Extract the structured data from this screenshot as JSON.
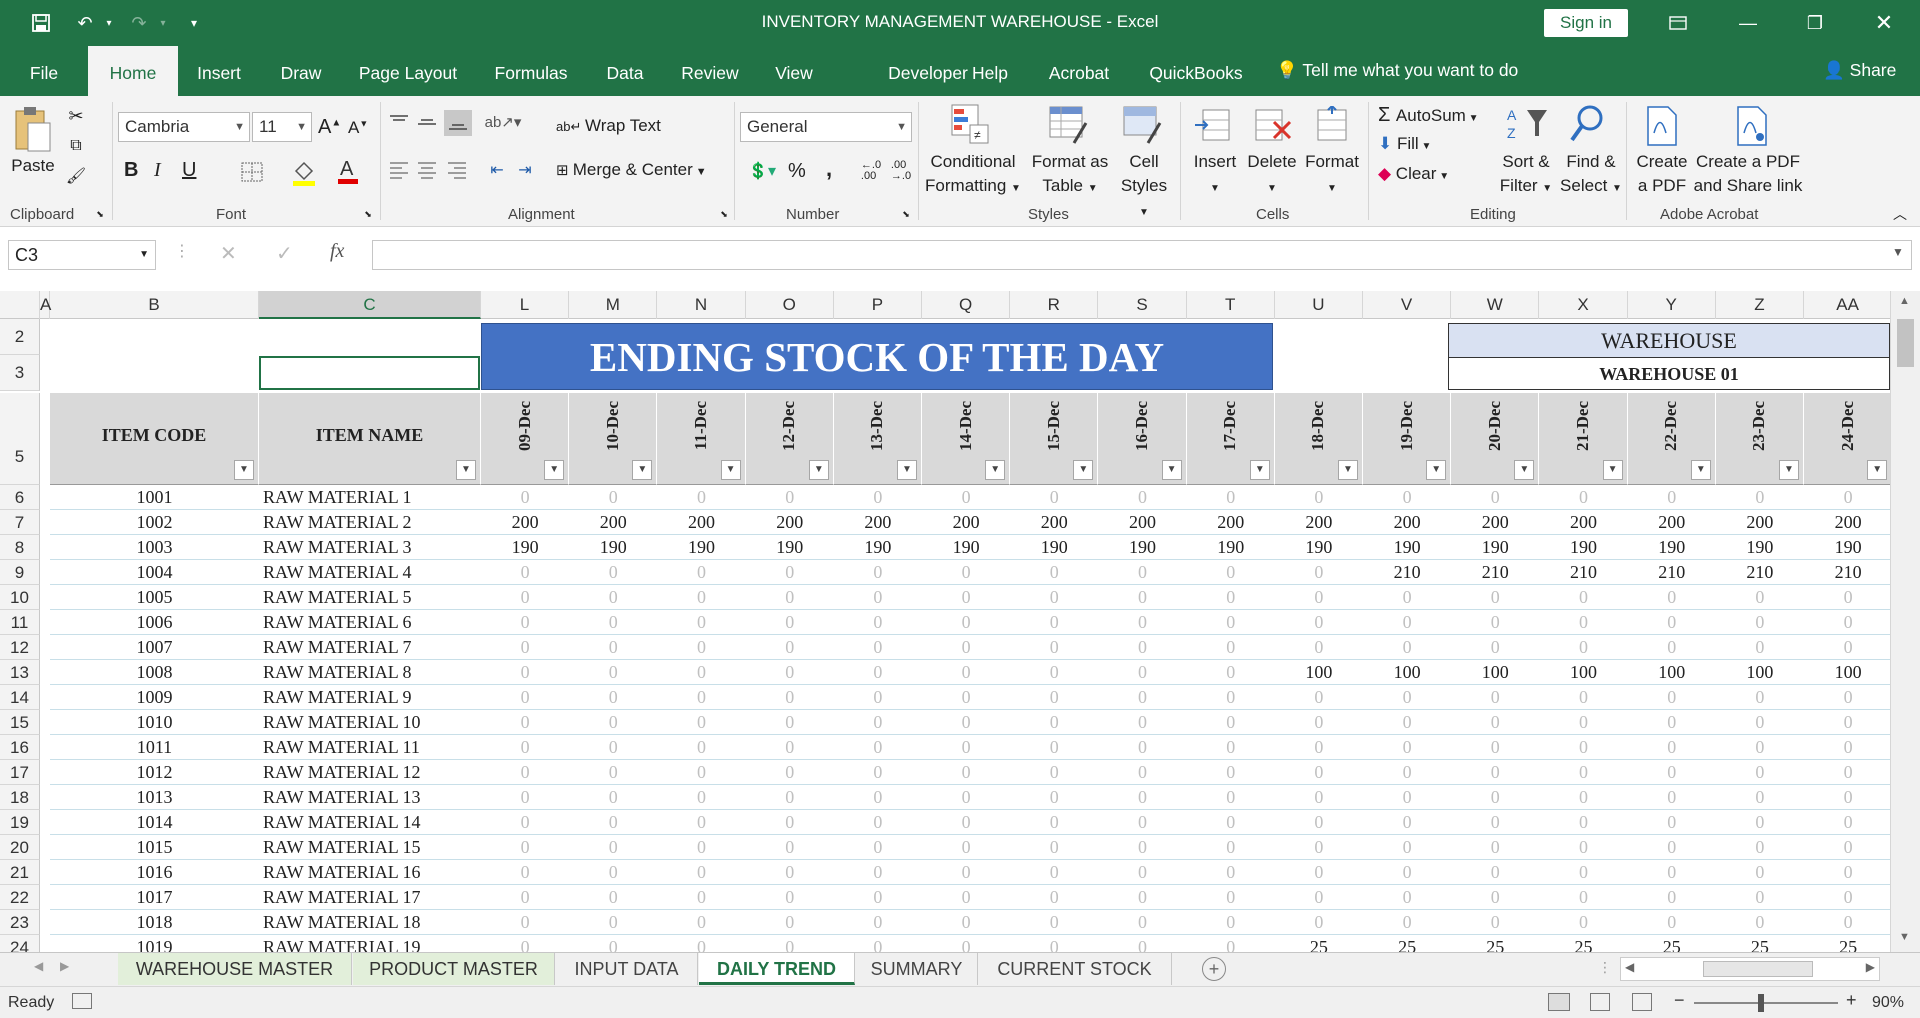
{
  "window": {
    "title": "INVENTORY MANAGEMENT WAREHOUSE  -  Excel",
    "sign_in": "Sign in"
  },
  "menu": {
    "tabs": [
      "File",
      "Home",
      "Insert",
      "Draw",
      "Page Layout",
      "Formulas",
      "Data",
      "Review",
      "View",
      "Developer",
      "Help",
      "Acrobat",
      "QuickBooks"
    ],
    "active": "Home",
    "tell_me": "Tell me what you want to do",
    "share": "Share"
  },
  "ribbon": {
    "clipboard": {
      "label": "Clipboard",
      "paste": "Paste"
    },
    "font": {
      "label": "Font",
      "family": "Cambria",
      "size": "11",
      "bold": "B",
      "italic": "I",
      "underline": "U"
    },
    "alignment": {
      "label": "Alignment",
      "wrap_text": "Wrap Text",
      "merge_center": "Merge & Center"
    },
    "number": {
      "label": "Number",
      "format": "General",
      "percent": "%",
      "comma": ","
    },
    "styles": {
      "label": "Styles",
      "conditional_1": "Conditional",
      "conditional_2": "Formatting",
      "format_table_1": "Format as",
      "format_table_2": "Table",
      "cell_styles_1": "Cell",
      "cell_styles_2": "Styles"
    },
    "cells": {
      "label": "Cells",
      "insert": "Insert",
      "delete": "Delete",
      "format": "Format"
    },
    "editing": {
      "label": "Editing",
      "autosum": "AutoSum",
      "fill": "Fill",
      "clear": "Clear",
      "sort_1": "Sort &",
      "sort_2": "Filter",
      "find_1": "Find &",
      "find_2": "Select"
    },
    "acrobat": {
      "label": "Adobe Acrobat",
      "create_pdf_1": "Create",
      "create_pdf_2": "a PDF",
      "share_pdf_1": "Create a PDF",
      "share_pdf_2": "and Share link"
    }
  },
  "formula_bar": {
    "name_box": "C3",
    "fx": "fx",
    "value": ""
  },
  "sheet": {
    "columns": [
      "A",
      "B",
      "C",
      "L",
      "M",
      "N",
      "O",
      "P",
      "Q",
      "R",
      "S",
      "T",
      "U",
      "V",
      "W",
      "X",
      "Y",
      "Z",
      "AA"
    ],
    "selected_column": "C",
    "banner": "ENDING STOCK OF THE DAY",
    "warehouse_label": "WAREHOUSE",
    "warehouse_value": "WAREHOUSE 01",
    "header_item_code": "ITEM CODE",
    "header_item_name": "ITEM NAME",
    "dates": [
      "09-Dec",
      "10-Dec",
      "11-Dec",
      "12-Dec",
      "13-Dec",
      "14-Dec",
      "15-Dec",
      "16-Dec",
      "17-Dec",
      "18-Dec",
      "19-Dec",
      "20-Dec",
      "21-Dec",
      "22-Dec",
      "23-Dec",
      "24-Dec"
    ],
    "header_rows": [
      "2",
      "3",
      "5"
    ],
    "rows": [
      {
        "row": "6",
        "code": "1001",
        "name": "RAW MATERIAL 1",
        "values": [
          0,
          0,
          0,
          0,
          0,
          0,
          0,
          0,
          0,
          0,
          0,
          0,
          0,
          0,
          0,
          0
        ]
      },
      {
        "row": "7",
        "code": "1002",
        "name": "RAW MATERIAL 2",
        "values": [
          200,
          200,
          200,
          200,
          200,
          200,
          200,
          200,
          200,
          200,
          200,
          200,
          200,
          200,
          200,
          200
        ]
      },
      {
        "row": "8",
        "code": "1003",
        "name": "RAW MATERIAL 3",
        "values": [
          190,
          190,
          190,
          190,
          190,
          190,
          190,
          190,
          190,
          190,
          190,
          190,
          190,
          190,
          190,
          190
        ]
      },
      {
        "row": "9",
        "code": "1004",
        "name": "RAW MATERIAL 4",
        "values": [
          0,
          0,
          0,
          0,
          0,
          0,
          0,
          0,
          0,
          0,
          210,
          210,
          210,
          210,
          210,
          210
        ]
      },
      {
        "row": "10",
        "code": "1005",
        "name": "RAW MATERIAL 5",
        "values": [
          0,
          0,
          0,
          0,
          0,
          0,
          0,
          0,
          0,
          0,
          0,
          0,
          0,
          0,
          0,
          0
        ]
      },
      {
        "row": "11",
        "code": "1006",
        "name": "RAW MATERIAL 6",
        "values": [
          0,
          0,
          0,
          0,
          0,
          0,
          0,
          0,
          0,
          0,
          0,
          0,
          0,
          0,
          0,
          0
        ]
      },
      {
        "row": "12",
        "code": "1007",
        "name": "RAW MATERIAL 7",
        "values": [
          0,
          0,
          0,
          0,
          0,
          0,
          0,
          0,
          0,
          0,
          0,
          0,
          0,
          0,
          0,
          0
        ]
      },
      {
        "row": "13",
        "code": "1008",
        "name": "RAW MATERIAL 8",
        "values": [
          0,
          0,
          0,
          0,
          0,
          0,
          0,
          0,
          0,
          100,
          100,
          100,
          100,
          100,
          100,
          100
        ]
      },
      {
        "row": "14",
        "code": "1009",
        "name": "RAW MATERIAL 9",
        "values": [
          0,
          0,
          0,
          0,
          0,
          0,
          0,
          0,
          0,
          0,
          0,
          0,
          0,
          0,
          0,
          0
        ]
      },
      {
        "row": "15",
        "code": "1010",
        "name": "RAW MATERIAL 10",
        "values": [
          0,
          0,
          0,
          0,
          0,
          0,
          0,
          0,
          0,
          0,
          0,
          0,
          0,
          0,
          0,
          0
        ]
      },
      {
        "row": "16",
        "code": "1011",
        "name": "RAW MATERIAL 11",
        "values": [
          0,
          0,
          0,
          0,
          0,
          0,
          0,
          0,
          0,
          0,
          0,
          0,
          0,
          0,
          0,
          0
        ]
      },
      {
        "row": "17",
        "code": "1012",
        "name": "RAW MATERIAL 12",
        "values": [
          0,
          0,
          0,
          0,
          0,
          0,
          0,
          0,
          0,
          0,
          0,
          0,
          0,
          0,
          0,
          0
        ]
      },
      {
        "row": "18",
        "code": "1013",
        "name": "RAW MATERIAL 13",
        "values": [
          0,
          0,
          0,
          0,
          0,
          0,
          0,
          0,
          0,
          0,
          0,
          0,
          0,
          0,
          0,
          0
        ]
      },
      {
        "row": "19",
        "code": "1014",
        "name": "RAW MATERIAL 14",
        "values": [
          0,
          0,
          0,
          0,
          0,
          0,
          0,
          0,
          0,
          0,
          0,
          0,
          0,
          0,
          0,
          0
        ]
      },
      {
        "row": "20",
        "code": "1015",
        "name": "RAW MATERIAL 15",
        "values": [
          0,
          0,
          0,
          0,
          0,
          0,
          0,
          0,
          0,
          0,
          0,
          0,
          0,
          0,
          0,
          0
        ]
      },
      {
        "row": "21",
        "code": "1016",
        "name": "RAW MATERIAL 16",
        "values": [
          0,
          0,
          0,
          0,
          0,
          0,
          0,
          0,
          0,
          0,
          0,
          0,
          0,
          0,
          0,
          0
        ]
      },
      {
        "row": "22",
        "code": "1017",
        "name": "RAW MATERIAL 17",
        "values": [
          0,
          0,
          0,
          0,
          0,
          0,
          0,
          0,
          0,
          0,
          0,
          0,
          0,
          0,
          0,
          0
        ]
      },
      {
        "row": "23",
        "code": "1018",
        "name": "RAW MATERIAL 18",
        "values": [
          0,
          0,
          0,
          0,
          0,
          0,
          0,
          0,
          0,
          0,
          0,
          0,
          0,
          0,
          0,
          0
        ]
      },
      {
        "row": "24",
        "code": "1019",
        "name": "RAW MATERIAL 19",
        "values": [
          0,
          0,
          0,
          0,
          0,
          0,
          0,
          0,
          0,
          25,
          25,
          25,
          25,
          25,
          25,
          25
        ]
      }
    ]
  },
  "sheet_tabs": [
    {
      "label": "WAREHOUSE MASTER",
      "style": "green"
    },
    {
      "label": "PRODUCT MASTER",
      "style": "green"
    },
    {
      "label": "INPUT DATA",
      "style": "plain"
    },
    {
      "label": "DAILY TREND",
      "style": "active"
    },
    {
      "label": "SUMMARY",
      "style": "plain"
    },
    {
      "label": "CURRENT STOCK",
      "style": "plain"
    }
  ],
  "status": {
    "ready": "Ready",
    "zoom": "90%"
  },
  "colors": {
    "excel_green": "#217346",
    "banner_blue": "#4472c4",
    "warehouse_fill": "#d9e1f2",
    "header_gray": "#d9d9d9"
  }
}
